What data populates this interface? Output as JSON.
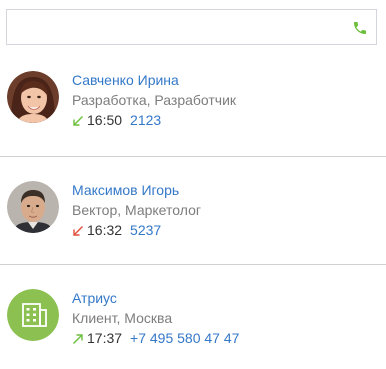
{
  "search": {
    "value": "",
    "placeholder": ""
  },
  "contacts": [
    {
      "name": "Савченко Ирина",
      "subtitle": "Разработка, Разработчик",
      "time": "16:50",
      "number": "2123",
      "direction": "incoming",
      "direction_icon": "arrow-down-left-icon",
      "direction_color": "#6cbf3c"
    },
    {
      "name": "Максимов Игорь",
      "subtitle": "Вектор, Маркетолог",
      "time": "16:32",
      "number": "5237",
      "direction": "missed",
      "direction_icon": "arrow-down-left-icon",
      "direction_color": "#e0503c"
    },
    {
      "name": "Атриус",
      "subtitle": "Клиент, Москва",
      "time": "17:37",
      "number": "+7 495 580 47 47",
      "direction": "outgoing",
      "direction_icon": "arrow-up-right-icon",
      "direction_color": "#6cbf3c"
    }
  ],
  "colors": {
    "accent_link": "#3478c8",
    "phone_green": "#6cbf3c",
    "company_avatar_bg": "#8cc152"
  }
}
